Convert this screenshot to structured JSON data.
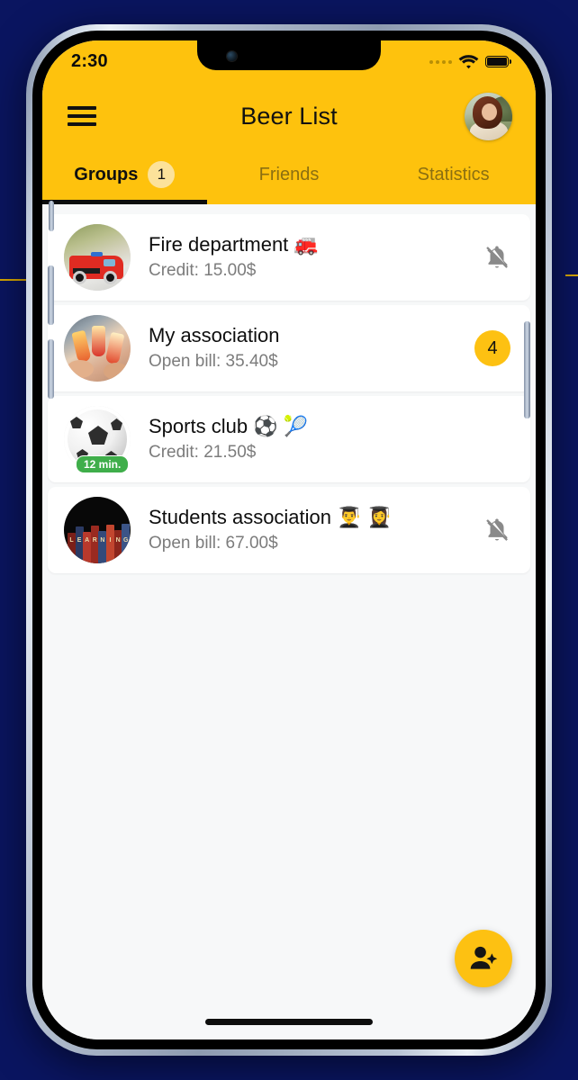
{
  "status_bar": {
    "time": "2:30",
    "signal_icon": "signal-dots-icon",
    "wifi_icon": "wifi-icon",
    "battery_icon": "battery-full-icon"
  },
  "app_bar": {
    "menu_icon": "hamburger-menu-icon",
    "title": "Beer List",
    "avatar_label": "profile-avatar"
  },
  "tabs": [
    {
      "label": "Groups",
      "badge": "1",
      "active": true
    },
    {
      "label": "Friends",
      "badge": null,
      "active": false
    },
    {
      "label": "Statistics",
      "badge": null,
      "active": false
    }
  ],
  "groups": [
    {
      "title": "Fire department 🚒",
      "subtitle": "Credit: 15.00$",
      "thumb": "fire-truck-photo",
      "time_chip": null,
      "right_icon": "bell-off-icon",
      "right_badge": null
    },
    {
      "title": "My association",
      "subtitle": "Open bill: 35.40$",
      "thumb": "cheers-drinks-photo",
      "time_chip": null,
      "right_icon": null,
      "right_badge": "4"
    },
    {
      "title": "Sports club ⚽ 🎾",
      "subtitle": "Credit: 21.50$",
      "thumb": "soccer-ball-photo",
      "time_chip": "12 min.",
      "right_icon": null,
      "right_badge": null
    },
    {
      "title": "Students association 👨‍🎓 👩‍🎓",
      "subtitle": "Open bill: 67.00$",
      "thumb": "books-learning-photo",
      "time_chip": null,
      "right_icon": "bell-off-icon",
      "right_badge": null
    }
  ],
  "fab": {
    "icon": "add-person-icon"
  },
  "colors": {
    "brand_yellow": "#FEC20D",
    "badge_yellow": "#FDC112",
    "tab_badge_cream": "#FCE29A",
    "page_background": "#0a1560",
    "list_background": "#f7f8f9",
    "time_chip_green": "#3fae4a",
    "muted_icon_gray": "#8a8a8a"
  }
}
